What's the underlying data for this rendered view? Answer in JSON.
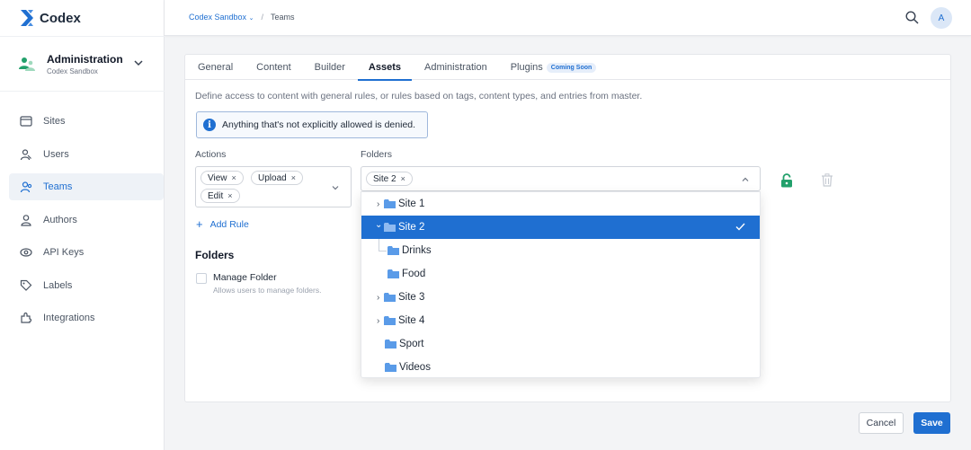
{
  "app": {
    "name": "Codex",
    "brand_color": "#1f6fd1"
  },
  "org": {
    "title": "Administration",
    "subtitle": "Codex Sandbox"
  },
  "sidebar": {
    "items": [
      {
        "label": "Sites",
        "icon": "sites-icon",
        "active": false
      },
      {
        "label": "Users",
        "icon": "users-icon",
        "active": false
      },
      {
        "label": "Teams",
        "icon": "teams-icon",
        "active": true
      },
      {
        "label": "Authors",
        "icon": "authors-icon",
        "active": false
      },
      {
        "label": "API Keys",
        "icon": "api-keys-icon",
        "active": false
      },
      {
        "label": "Labels",
        "icon": "labels-icon",
        "active": false
      },
      {
        "label": "Integrations",
        "icon": "integrations-icon",
        "active": false
      }
    ]
  },
  "breadcrumb": {
    "workspace": "Codex Sandbox",
    "current": "Teams"
  },
  "user": {
    "avatar_initial": "A"
  },
  "tabs": [
    {
      "label": "General",
      "active": false
    },
    {
      "label": "Content",
      "active": false
    },
    {
      "label": "Builder",
      "active": false
    },
    {
      "label": "Assets",
      "active": true
    },
    {
      "label": "Administration",
      "active": false
    },
    {
      "label": "Plugins",
      "active": false,
      "badge": "Coming Soon"
    }
  ],
  "assets": {
    "description": "Define access to content with general rules, or rules based on tags, content types, and entries from master.",
    "notice": "Anything that's not explicitly allowed is denied.",
    "actions_label": "Actions",
    "actions": [
      "View",
      "Upload",
      "Edit"
    ],
    "folders_label": "Folders",
    "folders_selected": [
      "Site 2"
    ],
    "add_rule": "Add Rule",
    "section_title": "Folders",
    "manage_folder": {
      "label": "Manage Folder",
      "help": "Allows users to manage folders."
    }
  },
  "folder_options": [
    {
      "label": "Site 1",
      "caret": "›",
      "level": 0,
      "selected": false
    },
    {
      "label": "Site 2",
      "caret": "⌄",
      "level": 0,
      "selected": true
    },
    {
      "label": "Drinks",
      "caret": "",
      "level": 1,
      "selected": false
    },
    {
      "label": "Food",
      "caret": "",
      "level": 1,
      "selected": false
    },
    {
      "label": "Site 3",
      "caret": "›",
      "level": 0,
      "selected": false
    },
    {
      "label": "Site 4",
      "caret": "›",
      "level": 0,
      "selected": false
    },
    {
      "label": "Sport",
      "caret": "",
      "level": 0,
      "selected": false
    },
    {
      "label": "Videos",
      "caret": "",
      "level": 0,
      "selected": false
    }
  ],
  "footer": {
    "cancel": "Cancel",
    "save": "Save"
  }
}
